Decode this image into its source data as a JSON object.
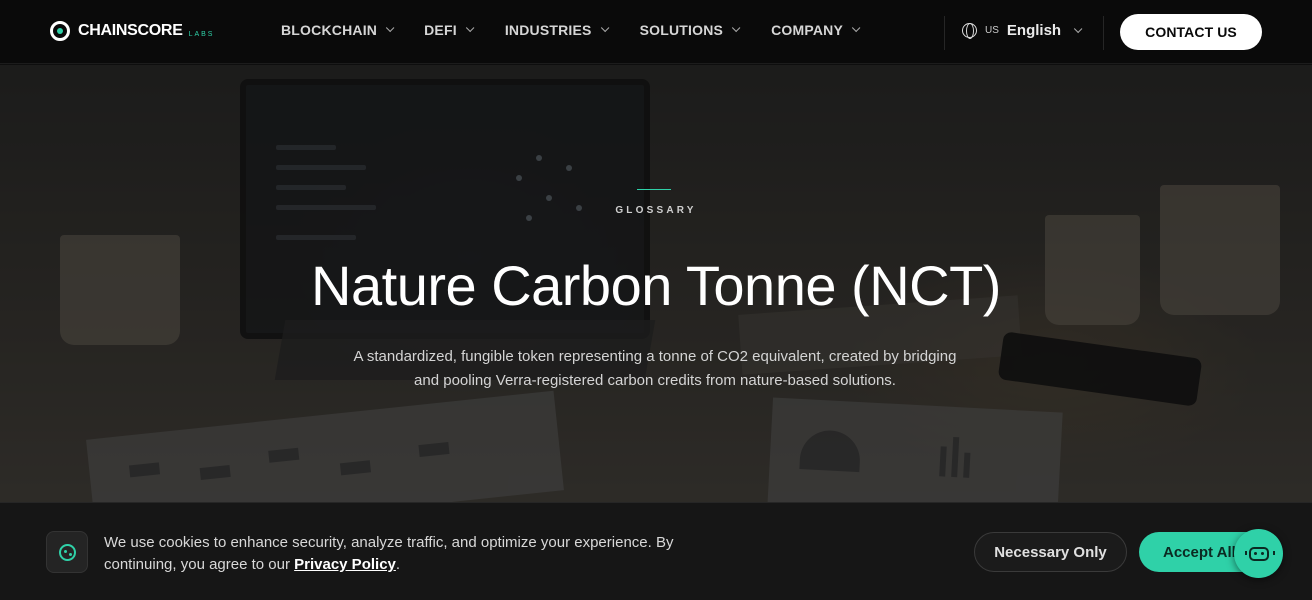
{
  "nav": {
    "logo_text": "CHAINSCORE",
    "logo_sub": "LABS",
    "menu": [
      {
        "label": "BLOCKCHAIN"
      },
      {
        "label": "DEFI"
      },
      {
        "label": "INDUSTRIES"
      },
      {
        "label": "SOLUTIONS"
      },
      {
        "label": "COMPANY"
      }
    ],
    "language": {
      "code": "US",
      "name": "English"
    },
    "contact_label": "CONTACT US"
  },
  "hero": {
    "eyebrow": "GLOSSARY",
    "title": "Nature Carbon Tonne (NCT)",
    "subtitle": "A standardized, fungible token representing a tonne of CO2 equivalent, created by bridging and pooling Verra-registered carbon credits from nature-based solutions."
  },
  "cookie": {
    "text_before": "We use cookies to enhance security, analyze traffic, and optimize your experience. By continuing, you agree to our ",
    "policy_link": "Privacy Policy",
    "text_after": ".",
    "necessary_label": "Necessary Only",
    "accept_label": "Accept All"
  },
  "colors": {
    "accent": "#2fd1a8",
    "nav_bg": "#0a0a0a",
    "cookie_bg": "#161616"
  }
}
